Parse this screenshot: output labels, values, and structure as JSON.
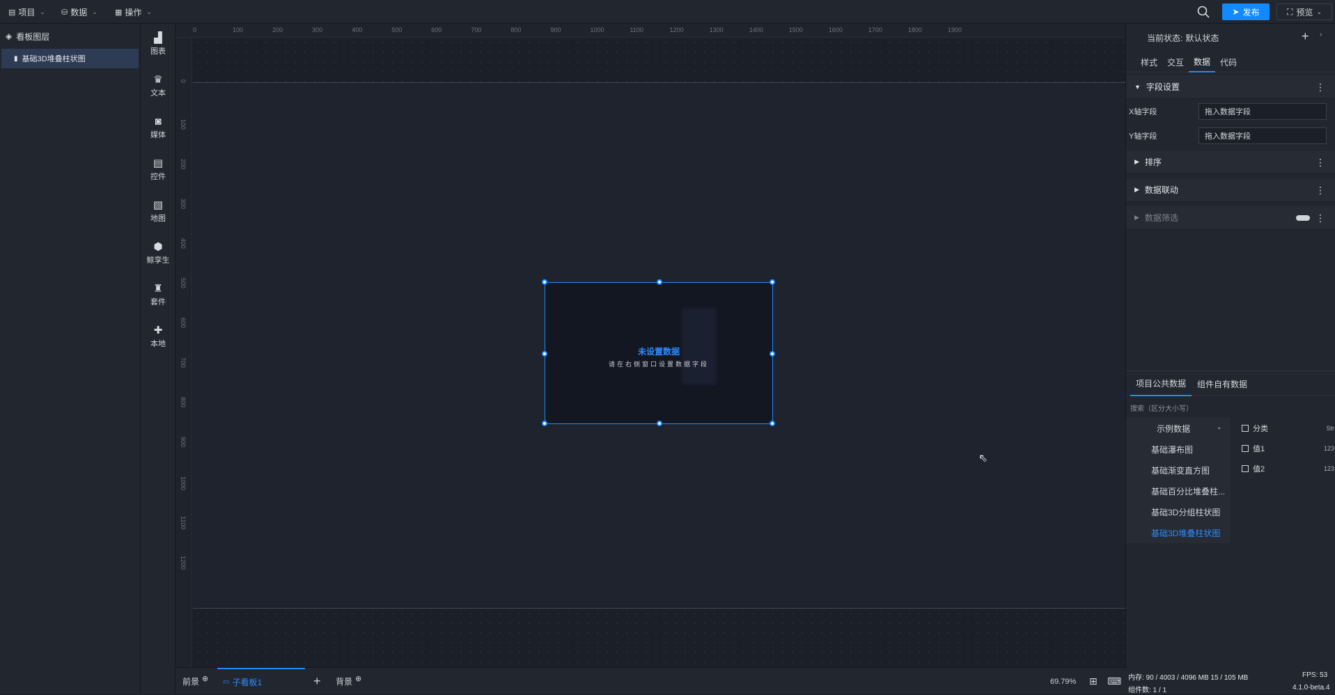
{
  "topbar": {
    "menus": [
      {
        "label": "项目",
        "icon": "document-icon"
      },
      {
        "label": "数据",
        "icon": "database-icon"
      },
      {
        "label": "操作",
        "icon": "grid-icon"
      }
    ],
    "publish_label": "发布",
    "preview_label": "预览"
  },
  "layers": {
    "title": "看板图层",
    "items": [
      {
        "label": "基础3D堆叠柱状图"
      }
    ]
  },
  "components": [
    {
      "label": "图表",
      "icon": "chart-icon"
    },
    {
      "label": "文本",
      "icon": "text-icon"
    },
    {
      "label": "媒体",
      "icon": "media-icon"
    },
    {
      "label": "控件",
      "icon": "control-icon"
    },
    {
      "label": "地图",
      "icon": "map-icon"
    },
    {
      "label": "鲸孪生",
      "icon": "cube-icon"
    },
    {
      "label": "套件",
      "icon": "shirt-icon"
    },
    {
      "label": "本地",
      "icon": "puzzle-icon"
    }
  ],
  "rulers": {
    "top": [
      "0",
      "100",
      "200",
      "300",
      "400",
      "500",
      "600",
      "700",
      "800",
      "900",
      "1000",
      "1100",
      "1200",
      "1300",
      "1400",
      "1500",
      "1600",
      "1700",
      "1800",
      "1900"
    ],
    "left": [
      "0",
      "100",
      "200",
      "300",
      "400",
      "500",
      "600",
      "700",
      "800",
      "900",
      "1000",
      "1100",
      "1200"
    ]
  },
  "widget": {
    "title": "未设置数据",
    "subtitle": "请在右侧窗口设置数据字段"
  },
  "bottom": {
    "tabs": [
      {
        "label": "前景"
      },
      {
        "label": "子看板1"
      },
      {
        "label": "背景"
      }
    ],
    "zoom": "69.79%"
  },
  "right_panel": {
    "state_label": "当前状态:",
    "state_value": "默认状态",
    "tabs": [
      "样式",
      "交互",
      "数据",
      "代码"
    ],
    "active_tab": "数据",
    "sections": {
      "fields": {
        "title": "字段设置",
        "x_label": "X轴字段",
        "x_placeholder": "拖入数据字段",
        "y_label": "Y轴字段",
        "y_placeholder": "拖入数据字段"
      },
      "sort": "排序",
      "link": "数据联动",
      "filter": "数据筛选"
    },
    "data_tabs": [
      "项目公共数据",
      "组件自有数据"
    ],
    "search_hint": "搜索（区分大小写）",
    "dataset": {
      "group": "示例数据",
      "items": [
        "基础瀑布图",
        "基础渐变直方图",
        "基础百分比堆叠柱...",
        "基础3D分组柱状图",
        "基础3D堆叠柱状图"
      ],
      "active": "基础3D堆叠柱状图"
    },
    "fields": [
      {
        "name": "分类",
        "type": "Str"
      },
      {
        "name": "值1",
        "type": "123"
      },
      {
        "name": "值2",
        "type": "123"
      }
    ]
  },
  "status": {
    "memory": "内存:  90 / 4003 / 4096 MB  15 / 105 MB",
    "fps": "FPS:  53",
    "components": "组件数: 1 / 1",
    "version": "4.1.0-beta.4"
  },
  "colors": {
    "accent": "#1f8cff",
    "bg": "#1b1f27",
    "panel": "#22262e"
  }
}
